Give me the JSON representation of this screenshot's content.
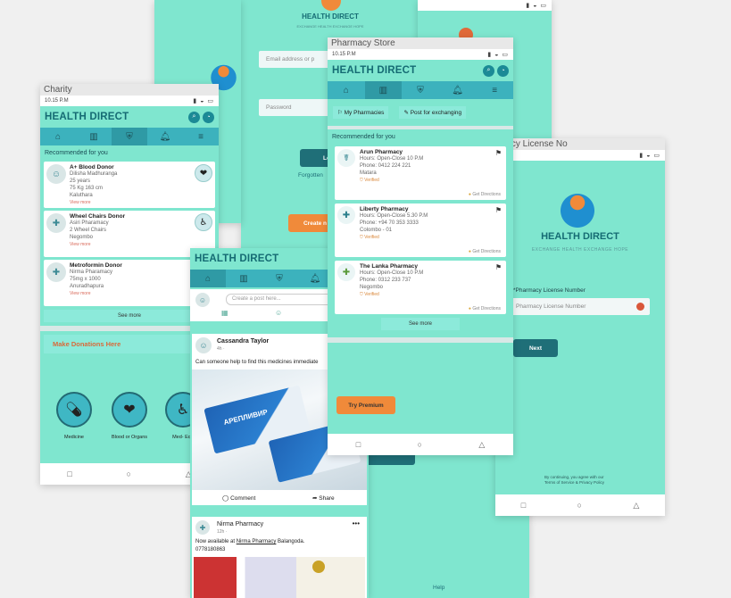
{
  "brand": "HEALTH DIRECT",
  "tagline": "EXCHANGE HEALTH EXCHANGE HOPE",
  "status": {
    "time": "10.15 P.M"
  },
  "charity": {
    "caption": "Charity",
    "section": "Recommended for you",
    "donors": [
      {
        "title": "A+ Blood Donor",
        "lines": [
          "Dilisha Madhuranga",
          "25 years",
          "75 Kg  163 cm",
          "Kaluthara"
        ],
        "link": "View more"
      },
      {
        "title": "Wheel Chairs Donor",
        "lines": [
          "Asiri Pharamacy",
          "2 Wheel Chairs",
          "Negombo"
        ],
        "link": "View more"
      },
      {
        "title": "Metroformin Donor",
        "lines": [
          "Nirma Pharamacy",
          "75mg x 1000",
          "Anuradhapura"
        ],
        "link": "View more"
      }
    ],
    "see_more": "See more",
    "donations_title": "Make Donations Here",
    "tiles": [
      "Medicine",
      "Blood or Organs",
      "Med- Equ"
    ]
  },
  "login": {
    "email_placeholder": "Email address or p",
    "password_placeholder": "Password",
    "login_label": "Lo",
    "forgotten": "Forgotten",
    "create_label": "Create n"
  },
  "store": {
    "caption": "Pharmacy Store",
    "my_pharmacies": "My Pharmacies",
    "post_exchange": "Post for exchanging",
    "section": "Recommended for you",
    "pharmacies": [
      {
        "name": "Arun Pharmacy",
        "hours": "Hours: Open-Close 10 P.M",
        "phone": "Phone: 0412 224 221",
        "city": "Matara",
        "verified": "Verified",
        "dirs": "Get Directions"
      },
      {
        "name": "Liberty Pharmacy",
        "hours": "Hours: Open-Close 5.30 P.M",
        "phone": "Phone: +94 70 353 3333",
        "city": "Colombo - 01",
        "verified": "Verified",
        "dirs": "Get Directions"
      },
      {
        "name": "The Lanka Pharmacy",
        "hours": "Hours: Open-Close 10 P.M",
        "phone": "Phone: 0312 233 737",
        "city": "Negombo",
        "verified": "Verified",
        "dirs": "Get Directions"
      }
    ],
    "see_more": "See more",
    "premium": "Try Premium"
  },
  "feed": {
    "post_placeholder": "Create a post here...",
    "post1": {
      "author": "Cassandra Taylor",
      "meta": "4h · ",
      "text": "Can someone help to find this medicines immediate",
      "box_text": "АРЕПЛИВИР"
    },
    "comment": "Comment",
    "share": "Share",
    "post2": {
      "author": "Nirma Pharmacy",
      "meta": "12h · ",
      "text_prefix": "Now available at ",
      "text_link": "Nirma Pharmacy",
      "text_suffix": " Balangoda.",
      "phone": "0778180863"
    },
    "help": "Help"
  },
  "license": {
    "caption": "macy License No",
    "label": "*Pharmacy License Number",
    "placeholder": "Pharmacy License Number",
    "next": "Next",
    "footer_line1": "By continuing, you agree with our",
    "footer_line2": "Terms of Service & Privacy Policy"
  }
}
